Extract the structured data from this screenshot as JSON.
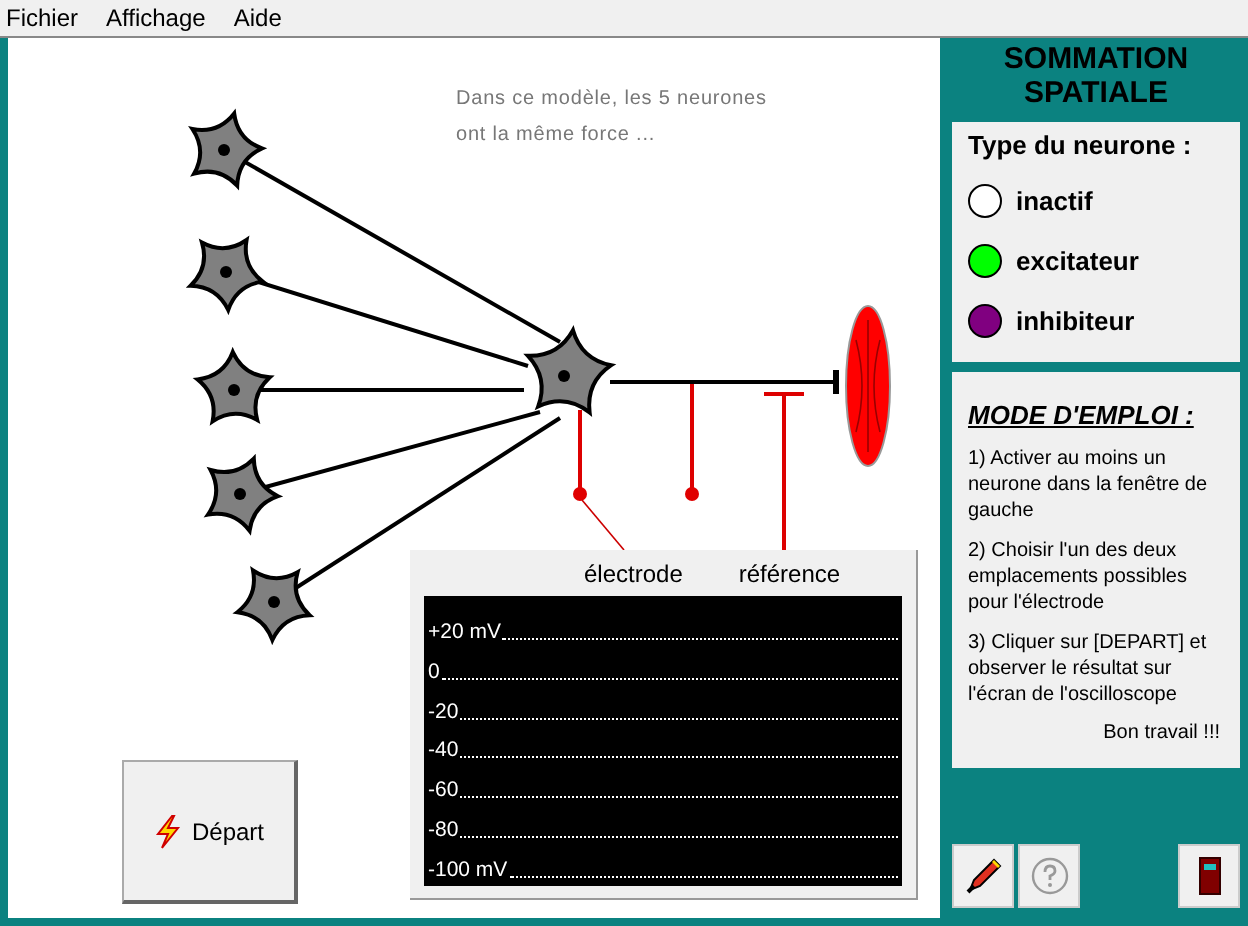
{
  "menu": [
    "Fichier",
    "Affichage",
    "Aide"
  ],
  "diagram": {
    "note_lines": [
      "Dans ce modèle, les 5 neurones",
      "ont la même force ..."
    ],
    "electrode_label": "électrode",
    "reference_label": "référence"
  },
  "oscilloscope": {
    "scale": [
      "+20 mV",
      "0",
      "-20",
      "-40",
      "-60",
      "-80",
      "-100 mV"
    ]
  },
  "start_button": "Départ",
  "title": "SOMMATION SPATIALE",
  "legend": {
    "title": "Type du neurone :",
    "items": [
      {
        "label": "inactif",
        "color": "#ffffff"
      },
      {
        "label": "excitateur",
        "color": "#00ff00"
      },
      {
        "label": "inhibiteur",
        "color": "#800080"
      }
    ]
  },
  "instructions": {
    "title": "MODE D'EMPLOI :",
    "steps": [
      "1) Activer au moins un neurone dans la fenêtre de gauche",
      "2) Choisir l'un des deux emplacements possibles pour l'électrode",
      "3) Cliquer sur [DEPART] et observer le résultat sur l'écran de l'oscilloscope"
    ],
    "closing": "Bon travail !!!"
  }
}
